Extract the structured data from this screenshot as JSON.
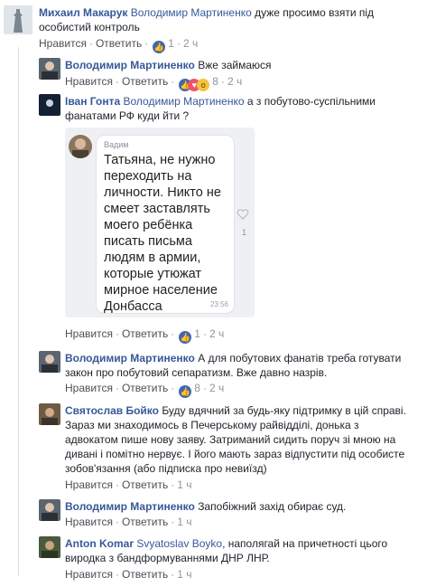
{
  "comments": [
    {
      "name": "Михаил Макарук",
      "mention": "Володимир Мартиненко",
      "text_line1": "дуже просимо взяти під",
      "text_line2": "особистий контроль",
      "like": "Нравится",
      "reply": "Ответить",
      "likes": "1",
      "time": "2 ч"
    },
    {
      "name": "Володимир Мартиненко",
      "text_line1": "Вже займаюся",
      "like": "Нравится",
      "reply": "Ответить",
      "likes": "8",
      "time": "2 ч"
    },
    {
      "name": "Іван Гонта",
      "mention": "Володимир Мартиненко",
      "text_line1": "а з побутово-суспільними",
      "text_line2": "фанатами РФ куди йти ?",
      "like": "Нравится",
      "reply": "Ответить",
      "likes": "1",
      "time": "2 ч",
      "screenshot": {
        "sender": "Вадим",
        "message": "Татьяна, не нужно переходить на личности. Никто не смеет заставлять моего ребёнка писать письма людям в армии, которые утюжат мирное население Донбасса",
        "time": "23:56",
        "heart_count": "1"
      }
    },
    {
      "name": "Володимир Мартиненко",
      "text_line1": "А для побутових фанатів треба готувати",
      "text_line2": "закон про побутовий сепаратизм. Вже давно назрів.",
      "like": "Нравится",
      "reply": "Ответить",
      "likes": "8",
      "time": "2 ч"
    },
    {
      "name": "Святослав Бойко",
      "text_line1": "Буду вдячний за будь-яку підтримку в цій справі.",
      "text_line2": "Зараз ми знаходимось в Печерському райвідділі, донька з",
      "text_line3": "адвокатом пише нову заяву. Затриманий сидить поруч зі мною на",
      "text_line4": "дивані і помітно нервує. І його мають зараз відпустити під особисте",
      "text_line5": "зобов'язання (або підписка про невиїзд)",
      "like": "Нравится",
      "reply": "Ответить",
      "time": "1 ч"
    },
    {
      "name": "Володимир Мартиненко",
      "text_line1": "Запобіжний захід обирає суд.",
      "like": "Нравится",
      "reply": "Ответить",
      "time": "1 ч"
    },
    {
      "name": "Anton Komar",
      "mention": "Svyatoslav Boyko",
      "text_line1": ", наполягай на причетності цього",
      "text_line2": "виродка з бандформуваннями ДНР ЛНР.",
      "like": "Нравится",
      "reply": "Ответить",
      "time": "1 ч"
    }
  ],
  "colors": {
    "link": "#365899",
    "meta": "#90949c",
    "like_blue": "#4267b2"
  },
  "icons": {
    "like": "thumbs-up-icon",
    "love": "heart-reaction-icon",
    "wow": "wow-reaction-icon"
  }
}
